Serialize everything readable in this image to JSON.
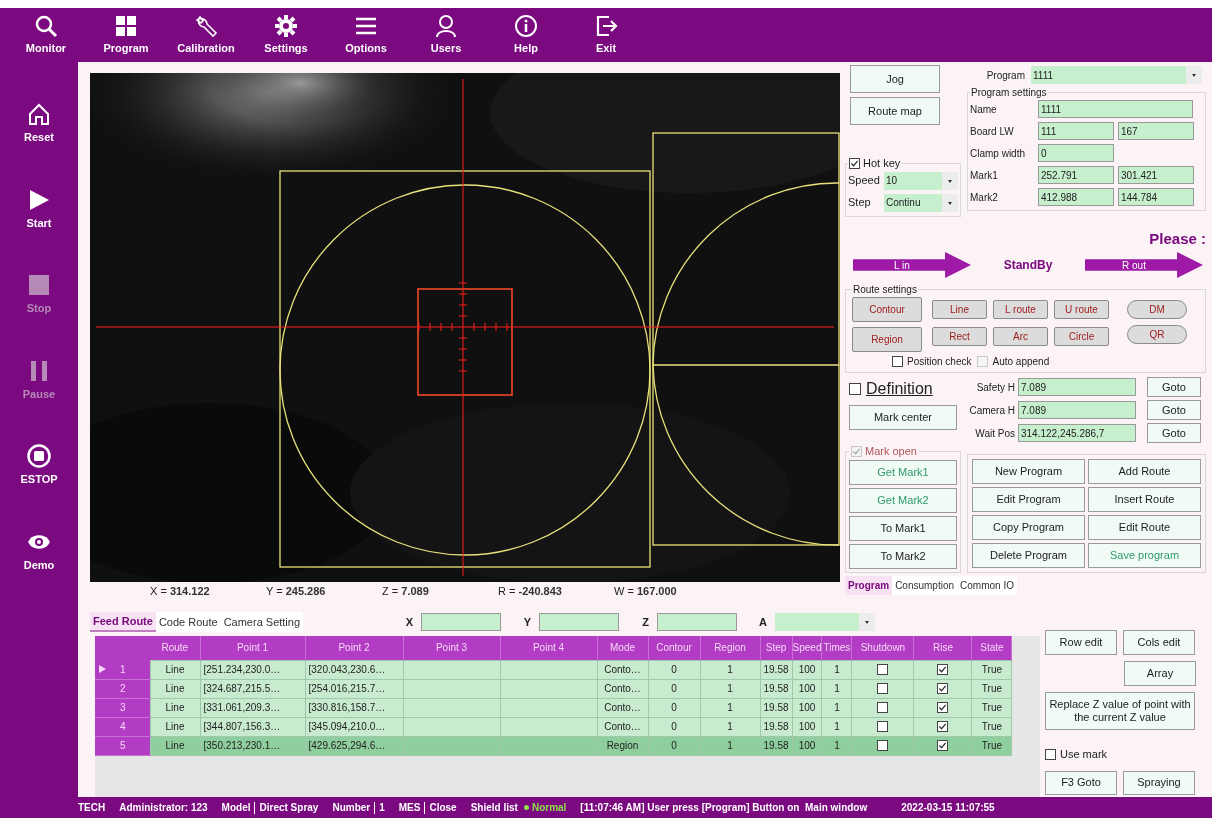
{
  "toolbar": [
    {
      "label": "Monitor"
    },
    {
      "label": "Program"
    },
    {
      "label": "Calibration"
    },
    {
      "label": "Settings"
    },
    {
      "label": "Options"
    },
    {
      "label": "Users"
    },
    {
      "label": "Help"
    },
    {
      "label": "Exit"
    }
  ],
  "sidebar": [
    {
      "label": "Reset",
      "disabled": false
    },
    {
      "label": "Start",
      "disabled": false
    },
    {
      "label": "Stop",
      "disabled": true
    },
    {
      "label": "Pause",
      "disabled": true
    },
    {
      "label": "ESTOP",
      "disabled": false
    },
    {
      "label": "Demo",
      "disabled": false
    }
  ],
  "readouts": [
    {
      "label": "X =",
      "value": "314.122"
    },
    {
      "label": "Y =",
      "value": "245.286"
    },
    {
      "label": "Z =",
      "value": "7.089"
    },
    {
      "label": "R =",
      "value": "-240.843"
    },
    {
      "label": "W =",
      "value": "167.000"
    }
  ],
  "jog_buttons": [
    "Jog",
    "Route map"
  ],
  "hot_key": {
    "label": "Hot key",
    "checked": true,
    "speed_label": "Speed",
    "speed": "10",
    "step_label": "Step",
    "step": "Continu"
  },
  "program": {
    "label": "Program",
    "value": "1111"
  },
  "program_settings": {
    "title": "Program settings",
    "rows": [
      {
        "label": "Name",
        "values": [
          "1111"
        ]
      },
      {
        "label": "Board LW",
        "values": [
          "111",
          "167"
        ]
      },
      {
        "label": "Clamp width",
        "values": [
          "0"
        ]
      },
      {
        "label": "Mark1",
        "values": [
          "252.791",
          "301.421"
        ]
      },
      {
        "label": "Mark2",
        "values": [
          "412.988",
          "144.784"
        ]
      }
    ]
  },
  "prompt": "Please :",
  "conveyor": {
    "left": "L in",
    "status": "StandBy",
    "right": "R out"
  },
  "route_settings": {
    "title": "Route settings",
    "primary": [
      "Contour",
      "Region"
    ],
    "shapes": [
      "Line",
      "L route",
      "U route",
      "Rect",
      "Arc",
      "Circle"
    ],
    "codes": [
      "DM",
      "QR"
    ],
    "checks": [
      {
        "label": "Position check",
        "checked": false,
        "disabled": false
      },
      {
        "label": "Auto append",
        "checked": false,
        "disabled": true
      }
    ]
  },
  "definition": {
    "label": "Definition",
    "checked": false
  },
  "mark_center": "Mark center",
  "heights": [
    {
      "label": "Safety H",
      "value": "7.089",
      "button": "Goto"
    },
    {
      "label": "Camera H",
      "value": "7.089",
      "button": "Goto"
    },
    {
      "label": "Wait Pos",
      "value": "314.122,245.286,7",
      "button": "Goto"
    }
  ],
  "mark_open": {
    "label": "Mark open",
    "checked": true,
    "disabled": true
  },
  "mark_buttons": [
    {
      "label": "Get Mark1",
      "kind": "accent"
    },
    {
      "label": "Get Mark2",
      "kind": "accent"
    },
    {
      "label": "To Mark1",
      "kind": "plain"
    },
    {
      "label": "To Mark2",
      "kind": "plain"
    }
  ],
  "program_buttons": [
    {
      "label": "New Program",
      "kind": "plain"
    },
    {
      "label": "Add Route",
      "kind": "plain"
    },
    {
      "label": "Edit Program",
      "kind": "plain"
    },
    {
      "label": "Insert Route",
      "kind": "plain"
    },
    {
      "label": "Copy Program",
      "kind": "plain"
    },
    {
      "label": "Edit Route",
      "kind": "plain"
    },
    {
      "label": "Delete Program",
      "kind": "plain"
    },
    {
      "label": "Save program",
      "kind": "accent"
    }
  ],
  "right_tabs": [
    {
      "label": "Program",
      "selected": true
    },
    {
      "label": "Consumption",
      "selected": false
    },
    {
      "label": "Common IO",
      "selected": false
    }
  ],
  "bottom_tabs": [
    {
      "label": "Feed Route",
      "selected": true
    },
    {
      "label": "Code Route",
      "selected": false
    },
    {
      "label": "Camera Setting",
      "selected": false
    }
  ],
  "axis_fields": [
    {
      "label": "X",
      "kind": "text"
    },
    {
      "label": "Y",
      "kind": "text"
    },
    {
      "label": "Z",
      "kind": "text"
    },
    {
      "label": "A",
      "kind": "select"
    }
  ],
  "table": {
    "columns": [
      "Route",
      "Point 1",
      "Point 2",
      "Point 3",
      "Point 4",
      "Mode",
      "Contour",
      "Region",
      "Step",
      "Speed",
      "Times",
      "Shutdown",
      "Rise",
      "State"
    ],
    "rows": [
      {
        "number": "1",
        "current": true,
        "selected": false,
        "route": "Line",
        "point_1": "[251.234,230.0…",
        "point_2": "[320.043,230.6…",
        "mode": "Conto…",
        "contour": "0",
        "region": "1",
        "step": "19.58",
        "speed": "100",
        "times": "1",
        "shutdown": false,
        "rise": true,
        "state": "True"
      },
      {
        "number": "2",
        "current": false,
        "selected": false,
        "route": "Line",
        "point_1": "[324.687,215.5…",
        "point_2": "[254.016,215.7…",
        "mode": "Conto…",
        "contour": "0",
        "region": "1",
        "step": "19.58",
        "speed": "100",
        "times": "1",
        "shutdown": false,
        "rise": true,
        "state": "True"
      },
      {
        "number": "3",
        "current": false,
        "selected": false,
        "route": "Line",
        "point_1": "[331.061,209.3…",
        "point_2": "[330.816,158.7…",
        "mode": "Conto…",
        "contour": "0",
        "region": "1",
        "step": "19.58",
        "speed": "100",
        "times": "1",
        "shutdown": false,
        "rise": true,
        "state": "True"
      },
      {
        "number": "4",
        "current": false,
        "selected": false,
        "route": "Line",
        "point_1": "[344.807,156.3…",
        "point_2": "[345.094,210.0…",
        "mode": "Conto…",
        "contour": "0",
        "region": "1",
        "step": "19.58",
        "speed": "100",
        "times": "1",
        "shutdown": false,
        "rise": true,
        "state": "True"
      },
      {
        "number": "5",
        "current": false,
        "selected": true,
        "route": "Line",
        "point_1": "[350.213,230.1…",
        "point_2": "[429.625,294.6…",
        "mode": "Region",
        "contour": "0",
        "region": "1",
        "step": "19.58",
        "speed": "100",
        "times": "1",
        "shutdown": false,
        "rise": true,
        "state": "True"
      }
    ]
  },
  "table_tools": {
    "row_edit": "Row edit",
    "cols_edit": "Cols edit",
    "array": "Array",
    "replace_z": "Replace Z value of point with the current Z value",
    "use_mark": {
      "label": "Use mark",
      "checked": false
    },
    "goto": "F3 Goto",
    "spraying": "Spraying"
  },
  "status_bar": {
    "fields": [
      {
        "label": "TECH"
      },
      {
        "label": "Administrator: 123"
      },
      {
        "label": "Model",
        "value": "Direct Spray"
      },
      {
        "label": "Number",
        "value": "1"
      },
      {
        "label": "MES",
        "value": "Close"
      },
      {
        "label": "Shield list"
      }
    ],
    "state": {
      "label": "Normal",
      "on": true
    },
    "message": "[11:07:46 AM] User press [Program] Button on  Main window",
    "datetime": "2022-03-15 11:07:55"
  }
}
